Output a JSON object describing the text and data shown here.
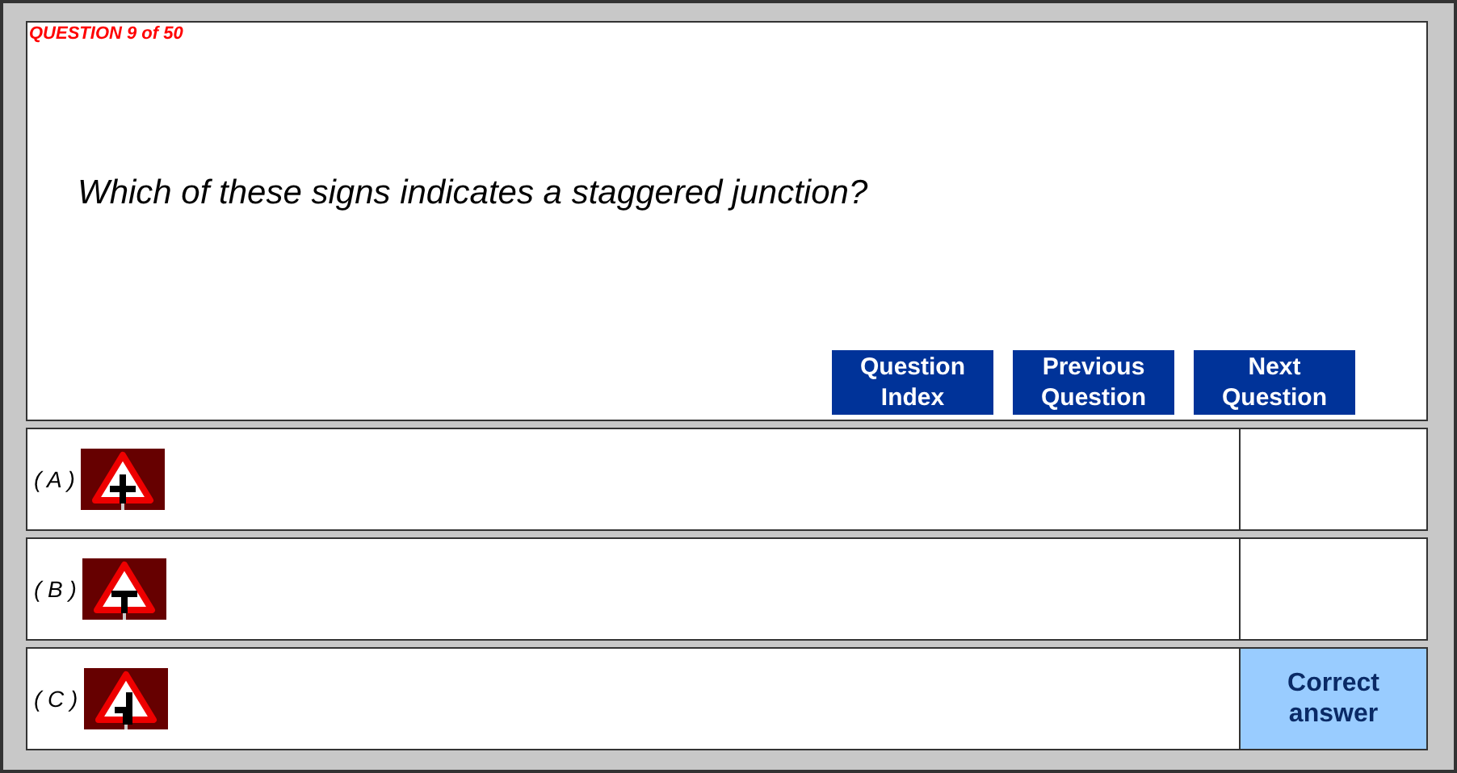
{
  "counter": "QUESTION 9 of 50",
  "question": "Which of these signs indicates a staggered junction?",
  "buttons": [
    "Question Index",
    "Previous Question",
    "Next Question"
  ],
  "answers": [
    {
      "label": "( A )",
      "kind": "crossroads",
      "correct": false
    },
    {
      "label": "( B )",
      "kind": "tjunction",
      "correct": false
    },
    {
      "label": "( C )",
      "kind": "staggered",
      "correct": true,
      "feedback": "Correct answer"
    }
  ]
}
